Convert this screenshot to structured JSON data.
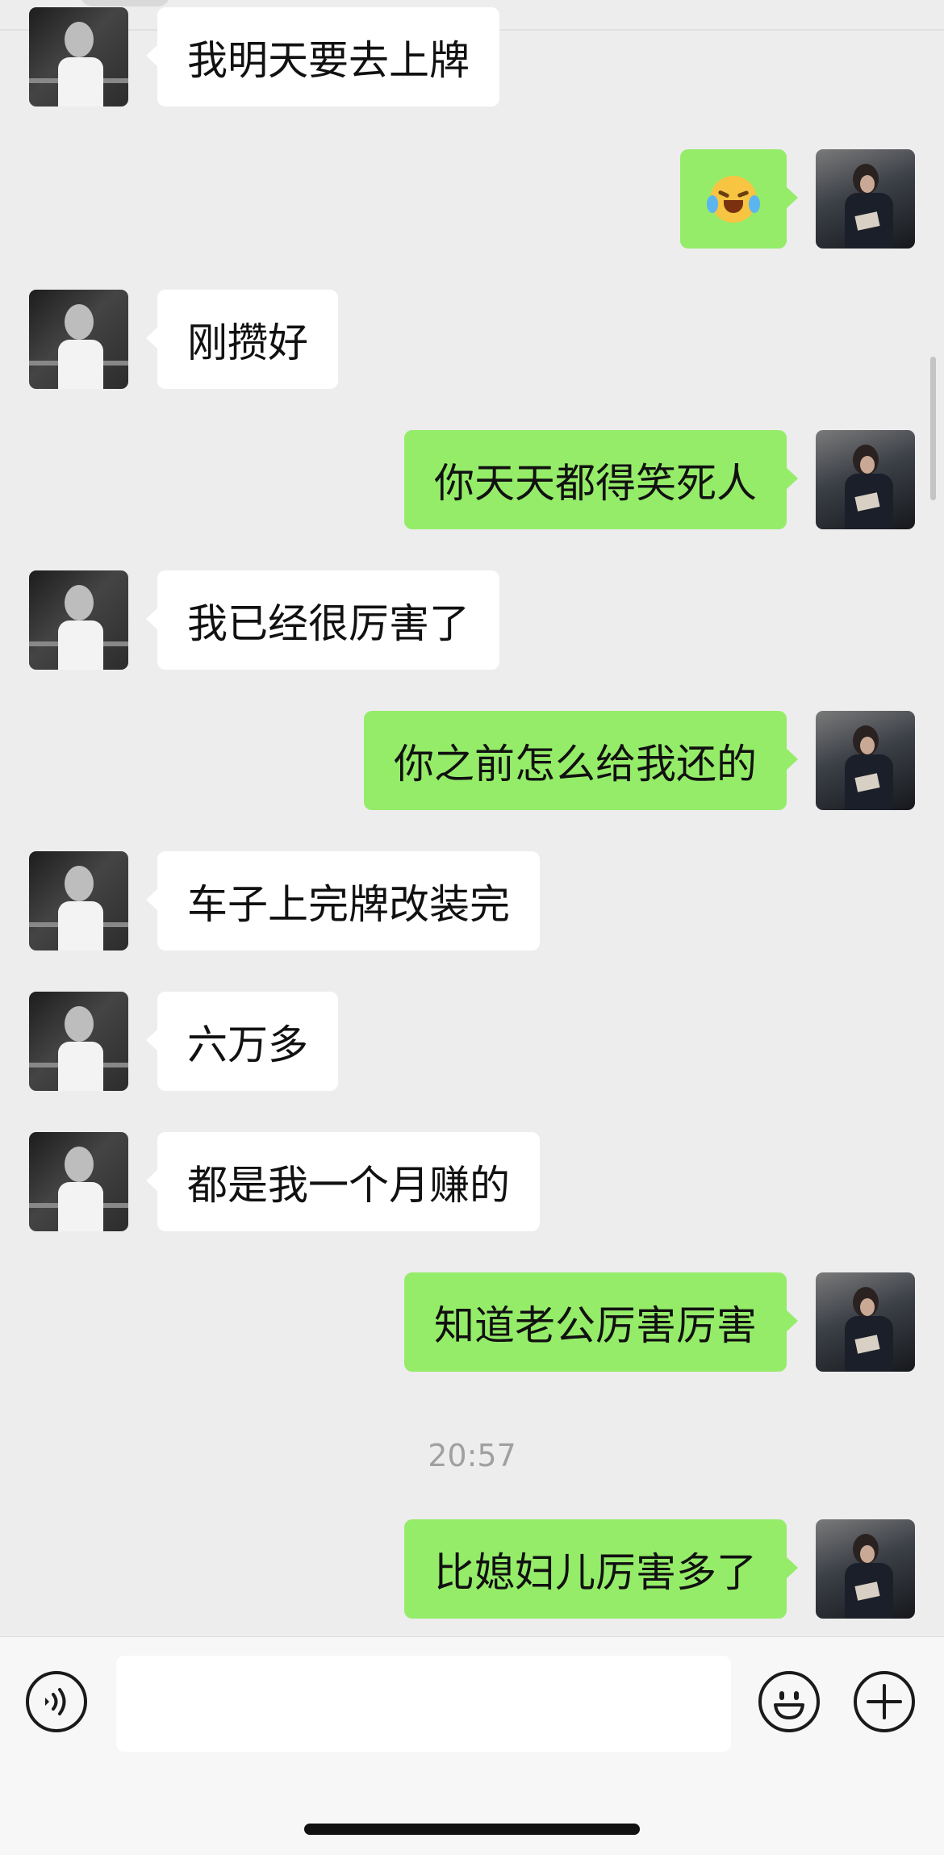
{
  "messages": [
    {
      "side": "in",
      "text": "我明天要去上牌"
    },
    {
      "side": "out",
      "text": "",
      "emoji": "crying-laughing"
    },
    {
      "side": "in",
      "text": "刚攒好"
    },
    {
      "side": "out",
      "text": "你天天都得笑死人"
    },
    {
      "side": "in",
      "text": "我已经很厉害了"
    },
    {
      "side": "out",
      "text": "你之前怎么给我还的"
    },
    {
      "side": "in",
      "text": "车子上完牌改装完"
    },
    {
      "side": "in",
      "text": "六万多"
    },
    {
      "side": "in",
      "text": "都是我一个月赚的"
    },
    {
      "side": "out",
      "text": "知道老公厉害厉害"
    },
    {
      "side": "out",
      "text": "比媳妇儿厉害多了"
    }
  ],
  "timestamp": "20:57",
  "input": {
    "value": "",
    "placeholder": ""
  },
  "colors": {
    "background": "#ededed",
    "incoming_bubble": "#ffffff",
    "outgoing_bubble": "#95ec69"
  },
  "icons": {
    "voice": "voice-icon",
    "emoji": "emoji-icon",
    "plus": "plus-icon"
  }
}
